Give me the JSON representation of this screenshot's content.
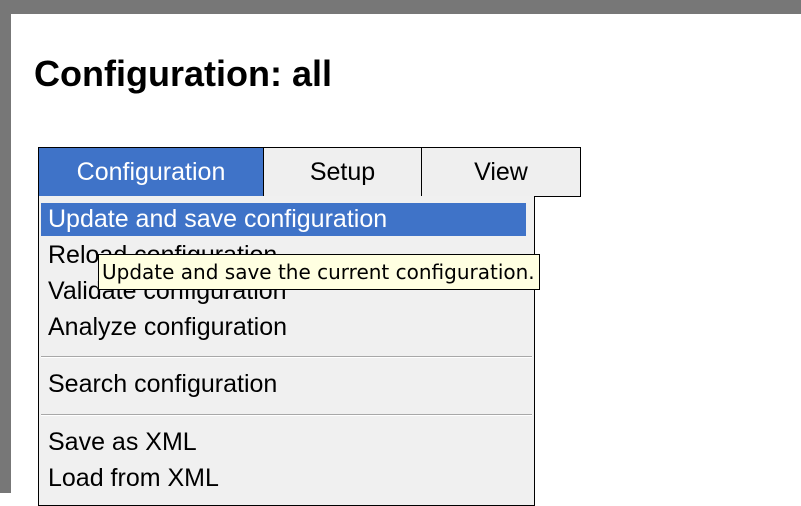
{
  "page": {
    "title": "Configuration: all"
  },
  "menubar": {
    "items": [
      {
        "label": "Configuration",
        "active": true
      },
      {
        "label": "Setup",
        "active": false
      },
      {
        "label": "View",
        "active": false
      }
    ]
  },
  "dropdown": {
    "items": [
      {
        "label": "Update and save configuration",
        "highlighted": true
      },
      {
        "label": "Reload configuration"
      },
      {
        "label": "Validate configuration"
      },
      {
        "label": "Analyze configuration"
      },
      {
        "label": "Search configuration"
      },
      {
        "label": "Save as XML"
      },
      {
        "label": "Load from XML"
      }
    ]
  },
  "tooltip": {
    "text": "Update and save the current configuration."
  },
  "colors": {
    "accent": "#3f73c8",
    "menu_background": "#efefef",
    "tooltip_background": "#ffffe1",
    "frame": "#777777"
  }
}
